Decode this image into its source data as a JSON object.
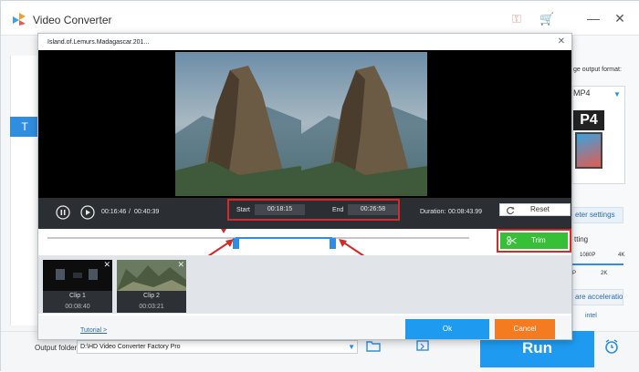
{
  "app": {
    "title": "Video Converter"
  },
  "sidebar": {
    "tab_letter": "T"
  },
  "right_panel": {
    "format_heading": "ge output format:",
    "format_selected": "MP4",
    "format_label_short": "P4",
    "params_button": "eter settings",
    "setting_label": "tting",
    "res_1080p": "1080P",
    "res_4k": "4K",
    "res_p": "P",
    "res_2k": "2K",
    "hw_accel_label": "are acceleration",
    "intel_label": "intel"
  },
  "bottom": {
    "output_folder_label": "Output folder:",
    "output_folder_value": "D:\\HD Video Converter Factory Pro",
    "run_label": "Run"
  },
  "dialog": {
    "title": "Island.of.Lemurs.Madagascar.201...",
    "current_time": "00:16:46",
    "separator": "/",
    "total_time": "00:40:39",
    "start_label": "Start",
    "start_value": "00:18:15",
    "end_label": "End",
    "end_value": "00:26:58",
    "duration_label": "Duration:",
    "duration_value": "00:08:43.99",
    "reset_label": "Reset",
    "trim_label": "Trim",
    "tutorial_label": "Tutorial >",
    "ok_label": "Ok",
    "cancel_label": "Cancel",
    "clips": [
      {
        "name": "Clip 1",
        "duration": "00:08:40"
      },
      {
        "name": "Clip 2",
        "duration": "00:03:21"
      }
    ]
  },
  "colors": {
    "accent": "#1e9bf0",
    "trim_green": "#37c037",
    "cancel_orange": "#f47b20",
    "highlight_red": "#d32a2a"
  }
}
